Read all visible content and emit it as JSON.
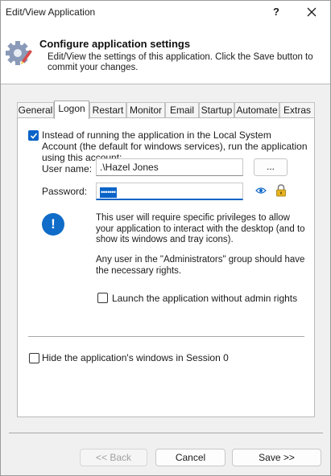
{
  "window": {
    "title": "Edit/View Application",
    "help_label": "?"
  },
  "header": {
    "title": "Configure application settings",
    "description": "Edit/View the settings of this application. Click the Save button to commit your changes."
  },
  "tabs": [
    {
      "label": "General",
      "active": false
    },
    {
      "label": "Logon",
      "active": true
    },
    {
      "label": "Restart",
      "active": false
    },
    {
      "label": "Monitor",
      "active": false
    },
    {
      "label": "Email",
      "active": false
    },
    {
      "label": "Startup",
      "active": false
    },
    {
      "label": "Automate",
      "active": false
    },
    {
      "label": "Extras",
      "active": false
    }
  ],
  "logon": {
    "run_as_account_checked": true,
    "run_as_account_label": "Instead of running the application in the Local System Account (the default for windows services), run the application using this account:",
    "username_label": "User name:",
    "username_value": ".\\Hazel Jones",
    "browse_label": "...",
    "password_label": "Password:",
    "password_mask": "•••••••",
    "info_line1": "This user will require specific privileges to allow your application to interact with the desktop (and to show its windows and tray icons).",
    "info_line2": "Any user in the \"Administrators\" group should have the necessary rights.",
    "launch_without_admin_checked": false,
    "launch_without_admin_label": "Launch the application without admin rights",
    "hide_session0_checked": false,
    "hide_session0_label": "Hide the application's windows in Session 0"
  },
  "footer": {
    "back_label": "<< Back",
    "cancel_label": "Cancel",
    "save_label": "Save >>"
  },
  "colors": {
    "accent": "#0a64c8",
    "info_icon": "#0f6cc8"
  }
}
